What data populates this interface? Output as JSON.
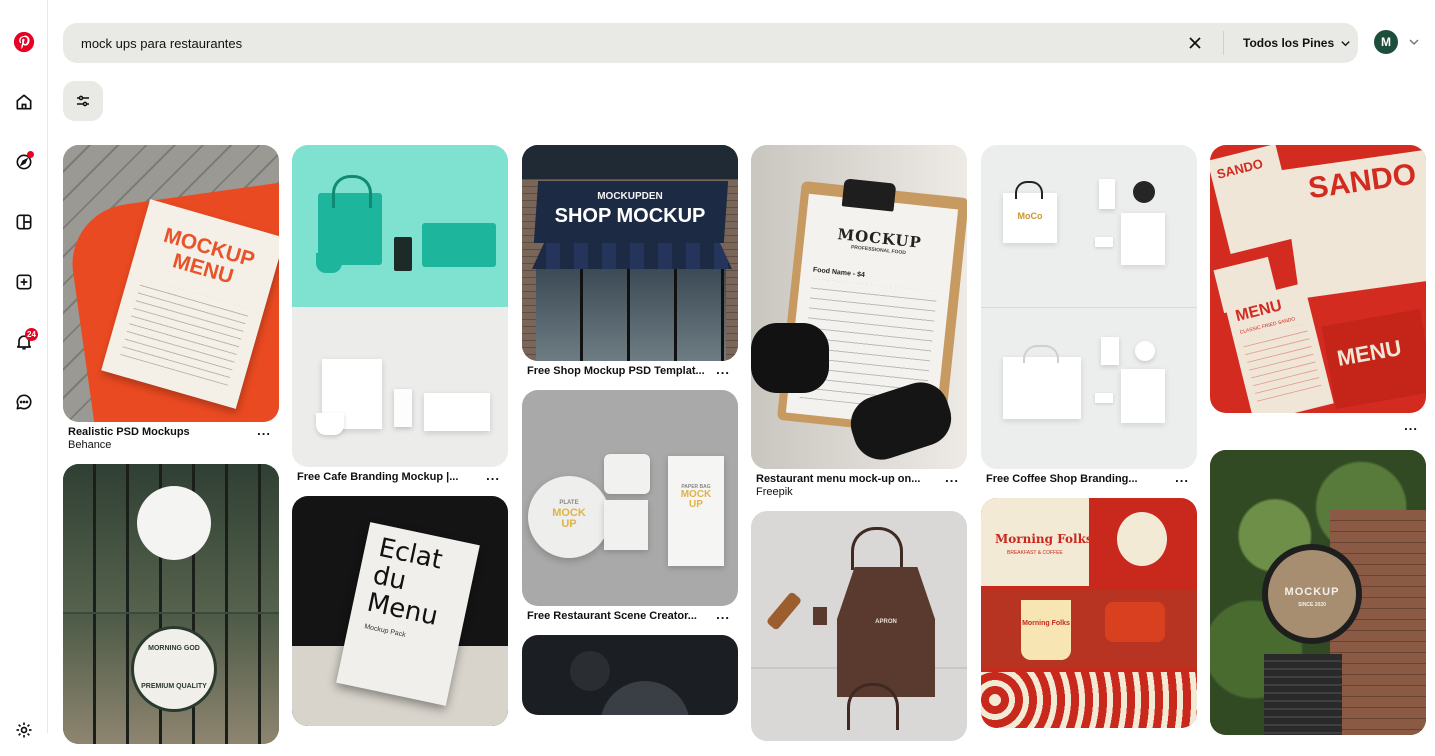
{
  "search": {
    "query": "mock ups para restaurantes",
    "scope_label": "Todos los Pines"
  },
  "account": {
    "initial": "M"
  },
  "notifications": {
    "count": "24"
  },
  "pin_more": "...",
  "pins": {
    "p1": {
      "title": "Realistic PSD Mockups",
      "subtitle": "Behance",
      "art": [
        "MOCKUP",
        "MENU"
      ]
    },
    "p2": {
      "art": [
        "MORNING GOD",
        "PREMIUM QUALITY"
      ]
    },
    "p3": {
      "title": "Free Cafe Branding Mockup |..."
    },
    "p4": {
      "art": [
        "Eclat",
        "du",
        "Menu",
        "Mockup Pack"
      ]
    },
    "p5": {
      "title": "Free Shop Mockup PSD Templat...",
      "art": [
        "MOCKUPDEN",
        "SHOP MOCKUP"
      ]
    },
    "p6": {
      "title": "Free Restaurant Scene Creator...",
      "art": [
        "PLATE",
        "MOCK UP",
        "PAPER BAG",
        "MOCK UP"
      ]
    },
    "p8": {
      "title": "Restaurant menu mock-up on...",
      "subtitle": "Freepik",
      "art": [
        "MOCKUP",
        "PROFESSIONAL FOOD",
        "Food Name - $4"
      ]
    },
    "p9": {
      "art": [
        "APRON"
      ]
    },
    "p10": {
      "title": "Free Coffee Shop Branding...",
      "art": [
        "MoCo"
      ]
    },
    "p11": {
      "art": [
        "Morning Folks",
        "BREAKFAST & COFFEE",
        "Morning Folks"
      ]
    },
    "p12": {
      "art": [
        "SANDO",
        "SANDO",
        "MENU",
        "MENU",
        "CLASSIC FRIED SANDO"
      ]
    },
    "p13": {
      "art": [
        "MOCKUP",
        "SINCE 2020"
      ]
    }
  }
}
